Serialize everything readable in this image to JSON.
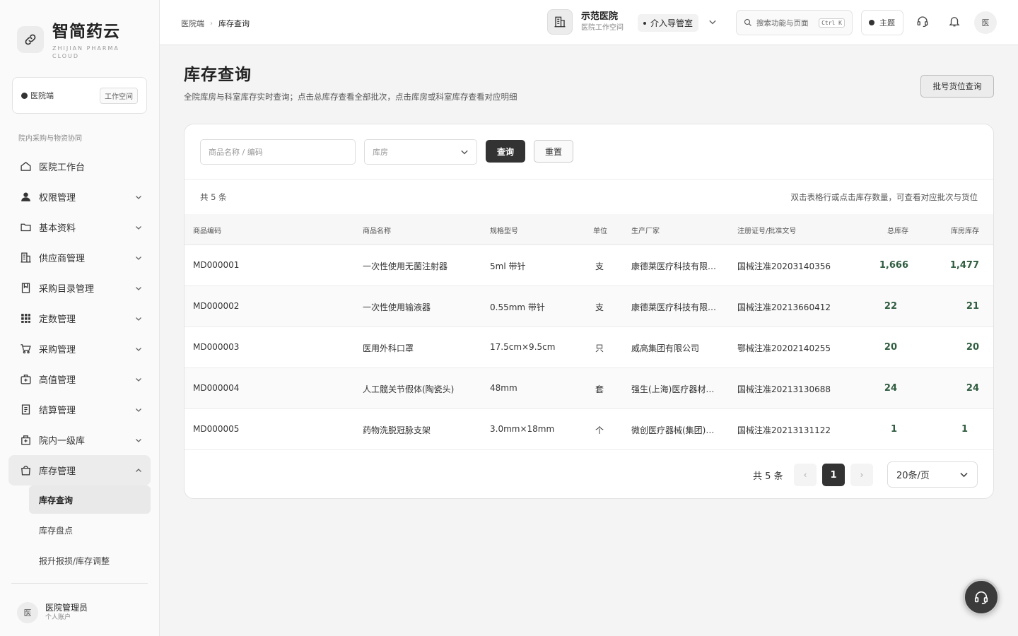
{
  "brand": {
    "title": "智简药云",
    "subtitle": "ZHIJIAN PHARMA CLOUD"
  },
  "workspace": {
    "label": "医院端",
    "button": "工作空间"
  },
  "nav": {
    "section": "院内采购与物资协同",
    "items": [
      {
        "label": "医院工作台",
        "icon": "home-icon"
      },
      {
        "label": "权限管理",
        "icon": "user-icon"
      },
      {
        "label": "基本资料",
        "icon": "folder-icon"
      },
      {
        "label": "供应商管理",
        "icon": "building-icon"
      },
      {
        "label": "采购目录管理",
        "icon": "book-icon"
      },
      {
        "label": "定数管理",
        "icon": "grid-icon"
      },
      {
        "label": "采购管理",
        "icon": "cart-icon"
      },
      {
        "label": "高值管理",
        "icon": "medkit-icon"
      },
      {
        "label": "结算管理",
        "icon": "receipt-icon"
      },
      {
        "label": "院内一级库",
        "icon": "store-icon"
      },
      {
        "label": "库存管理",
        "icon": "bag-icon"
      }
    ],
    "sub": [
      "库存查询",
      "库存盘点",
      "报升报损/库存调整"
    ]
  },
  "user": {
    "avatar": "医",
    "name": "医院管理员",
    "sub": "个人账户"
  },
  "topbar": {
    "crumb_root": "医院端",
    "crumb_sep": "›",
    "crumb_current": "库存查询",
    "hospital_name": "示范医院",
    "hospital_sub": "医院工作空间",
    "department": "介入导管室",
    "search_placeholder": "搜索功能与页面",
    "search_kbd": "Ctrl K",
    "theme": "主题",
    "avatar": "医"
  },
  "page": {
    "title": "库存查询",
    "desc": "全院库房与科室库存实时查询；点击总库存查看全部批次，点击库房或科室库存查看对应明细",
    "batch_button": "批号货位查询"
  },
  "filters": {
    "name_placeholder": "商品名称 / 编码",
    "warehouse_placeholder": "库房",
    "query": "查询",
    "reset": "重置"
  },
  "table": {
    "count": "共 5 条",
    "hint": "双击表格行或点击库存数量，可查看对应批次与货位",
    "headers": [
      "商品编码",
      "商品名称",
      "规格型号",
      "单位",
      "生产厂家",
      "注册证号/批准文号",
      "总库存",
      "库房库存"
    ],
    "rows": [
      [
        "MD000001",
        "一次性使用无菌注射器",
        "5ml 带针",
        "支",
        "康德莱医疗科技有限…",
        "国械注准20203140356",
        "1,666",
        "1,477"
      ],
      [
        "MD000002",
        "一次性使用输液器",
        "0.55mm 带针",
        "支",
        "康德莱医疗科技有限…",
        "国械注准20213660412",
        "22",
        "21"
      ],
      [
        "MD000003",
        "医用外科口罩",
        "17.5cm×9.5cm",
        "只",
        "威高集团有限公司",
        "鄂械注准20202140255",
        "20",
        "20"
      ],
      [
        "MD000004",
        "人工髋关节假体(陶瓷头)",
        "48mm",
        "套",
        "强生(上海)医疗器材…",
        "国械注准20213130688",
        "24",
        "24"
      ],
      [
        "MD000005",
        "药物洗脱冠脉支架",
        "3.0mm×18mm",
        "个",
        "微创医疗器械(集团)…",
        "国械注准20213131122",
        "1",
        "1"
      ]
    ]
  },
  "pager": {
    "total": "共 5 条",
    "current": "1",
    "prev": "‹",
    "next": "›",
    "size": "20条/页"
  },
  "colors": {
    "accent": "#333333",
    "stock_number": "#2f5d3f"
  }
}
